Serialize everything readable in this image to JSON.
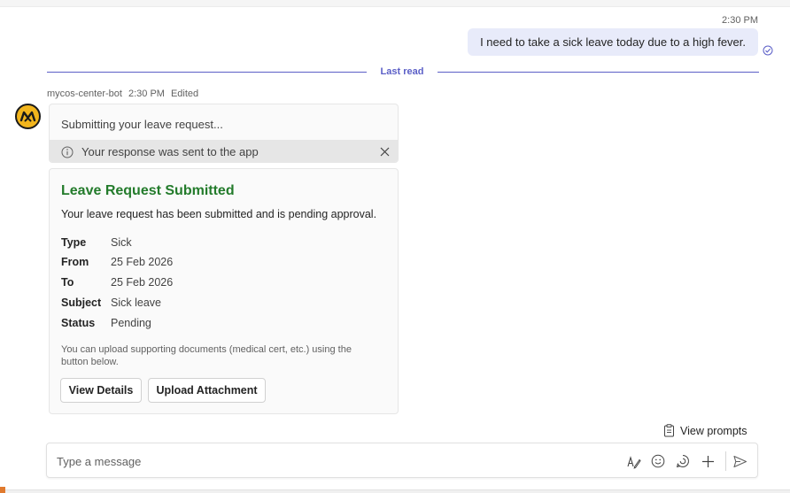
{
  "sent_message": {
    "time": "2:30 PM",
    "text": "I need to take a sick leave today due to a high fever."
  },
  "divider": {
    "label": "Last read"
  },
  "bot": {
    "name": "mycos-center-bot",
    "time": "2:30 PM",
    "status": "Edited"
  },
  "card_submitting": {
    "text": "Submitting your leave request...",
    "notice": "Your response was sent to the app"
  },
  "card_result": {
    "title": "Leave Request Submitted",
    "description": "Your leave request has been submitted and is pending approval.",
    "facts": [
      {
        "label": "Type",
        "value": "Sick"
      },
      {
        "label": "From",
        "value": "25 Feb 2026"
      },
      {
        "label": "To",
        "value": "25 Feb 2026"
      },
      {
        "label": "Subject",
        "value": "Sick leave"
      },
      {
        "label": "Status",
        "value": "Pending"
      }
    ],
    "note": "You can upload supporting documents (medical cert, etc.) using the button below.",
    "buttons": {
      "view_details": "View Details",
      "upload": "Upload Attachment"
    }
  },
  "view_prompts": "View prompts",
  "composer": {
    "placeholder": "Type a message"
  },
  "colors": {
    "accent": "#5b5fc7",
    "sent_bubble": "#e8ebfa",
    "success_title": "#237b2b",
    "avatar_bg": "#f2b51d"
  },
  "icons": {
    "read_receipt": "check-circle-icon",
    "notice": "info-icon",
    "close": "close-icon",
    "prompts": "clipboard-icon",
    "format": "format-pen-icon",
    "emoji": "emoji-icon",
    "loop": "loop-icon",
    "add": "plus-icon",
    "send": "send-icon"
  }
}
